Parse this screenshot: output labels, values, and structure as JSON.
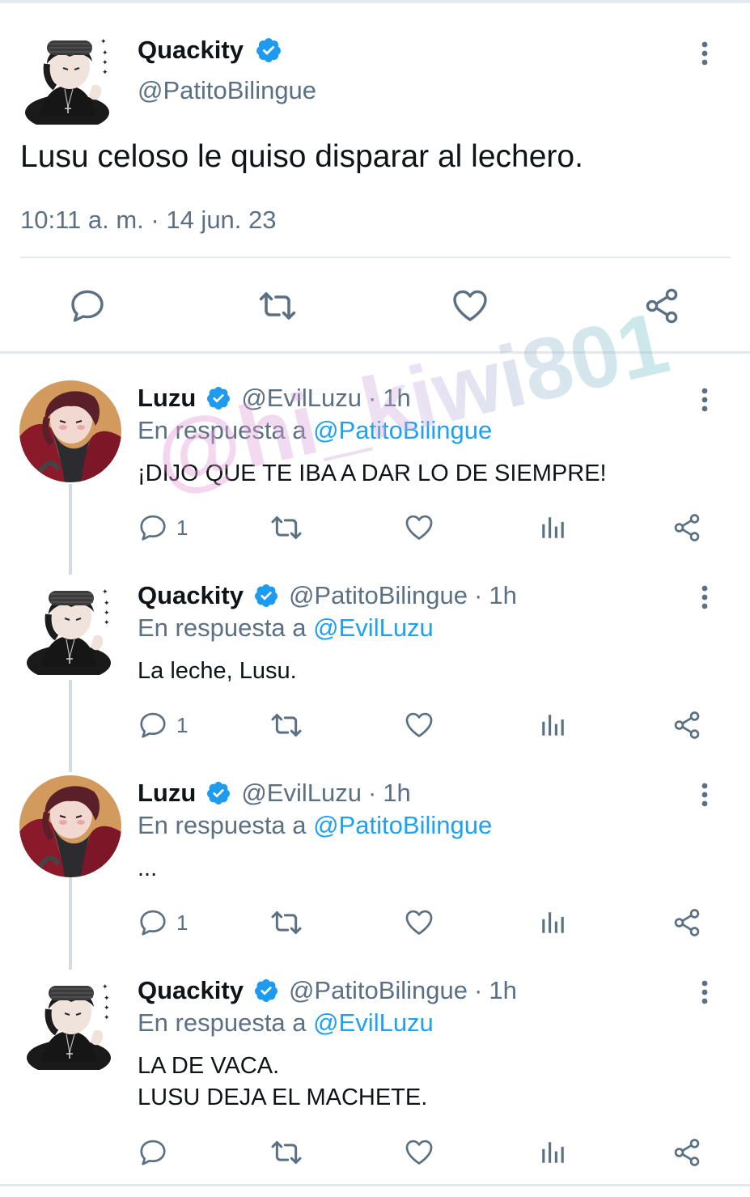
{
  "main_tweet": {
    "name": "Quackity",
    "handle": "@PatitoBilingue",
    "text": "Lusu celoso le quiso disparar al lechero.",
    "time": "10:11 a. m. · 14 jun. 23",
    "actions": [
      "reply-icon",
      "retweet-icon",
      "like-icon",
      "share-icon"
    ]
  },
  "replies": [
    {
      "name": "Luzu",
      "handle": "@EvilLuzu",
      "dot": "·",
      "ago": "1h",
      "in_reply_prefix": "En respuesta a",
      "in_reply_to": "@PatitoBilingue",
      "text": "¡DIJO QUE TE IBA A DAR LO DE SIEMPRE!",
      "reply_count": "1"
    },
    {
      "name": "Quackity",
      "handle": "@PatitoBilingue",
      "dot": "·",
      "ago": "1h",
      "in_reply_prefix": "En respuesta a",
      "in_reply_to": "@EvilLuzu",
      "text": "La leche, Lusu.",
      "reply_count": "1"
    },
    {
      "name": "Luzu",
      "handle": "@EvilLuzu",
      "dot": "·",
      "ago": "1h",
      "in_reply_prefix": "En respuesta a",
      "in_reply_to": "@PatitoBilingue",
      "text": "...",
      "reply_count": "1"
    },
    {
      "name": "Quackity",
      "handle": "@PatitoBilingue",
      "dot": "·",
      "ago": "1h",
      "in_reply_prefix": "En respuesta a",
      "in_reply_to": "@EvilLuzu",
      "text_line1": "LA DE VACA.",
      "text_line2": "LUSU DEJA EL MACHETE.",
      "reply_count": ""
    }
  ],
  "watermark": "@hi_kiwi801",
  "colors": {
    "link": "#1da1f2",
    "secondary_text": "#5b7083",
    "verified": "#1d9bf0",
    "divider": "#e6e9ec"
  }
}
